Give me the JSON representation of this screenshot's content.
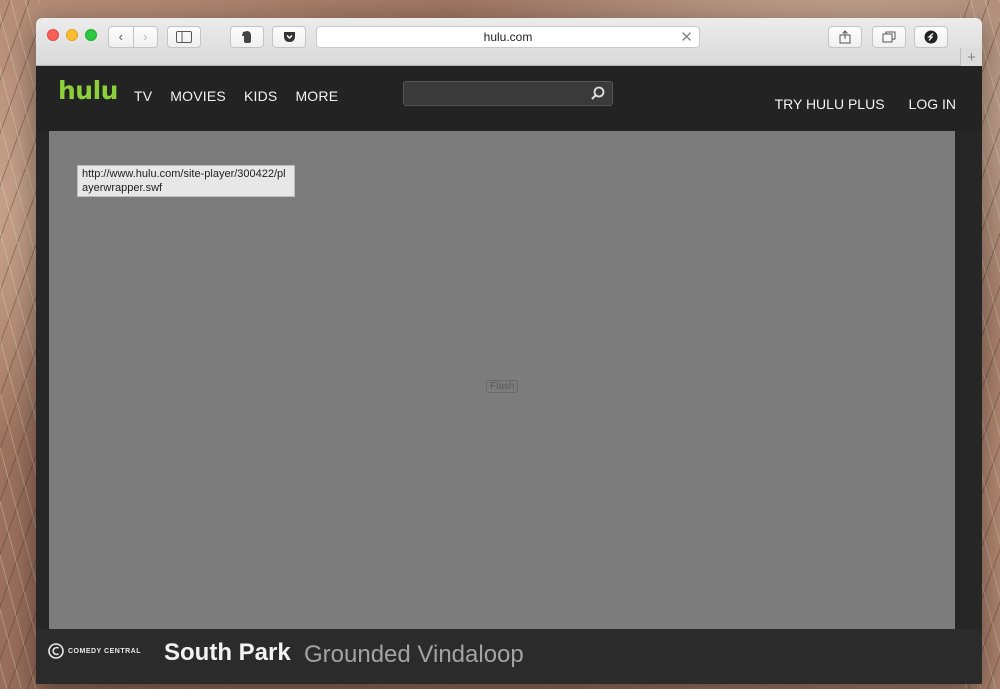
{
  "browser": {
    "url": "hulu.com",
    "icons": {
      "back": "chevron-left-icon",
      "forward": "chevron-right-icon",
      "sidebar": "sidebar-icon",
      "evernote": "evernote-icon",
      "pocket": "pocket-icon",
      "close": "close-icon",
      "share": "share-icon",
      "tabs": "tabs-icon",
      "extension": "extension-icon",
      "new_tab": "plus-icon"
    }
  },
  "header": {
    "logo": "hulu",
    "nav": [
      "TV",
      "MOVIES",
      "KIDS",
      "MORE"
    ],
    "search_placeholder": "",
    "right_nav": [
      "TRY HULU PLUS",
      "LOG IN"
    ]
  },
  "player": {
    "url_tooltip": "http://www.hulu.com/site-player/300422/playerwrapper.swf",
    "plugin_label": "Flash"
  },
  "info": {
    "network": "COMEDY CENTRAL",
    "show_title": "South Park",
    "episode_title": "Grounded Vindaloop"
  },
  "colors": {
    "hulu_green": "#8bd03b",
    "header_bg": "#232323",
    "player_bg": "#7c7c7c"
  }
}
